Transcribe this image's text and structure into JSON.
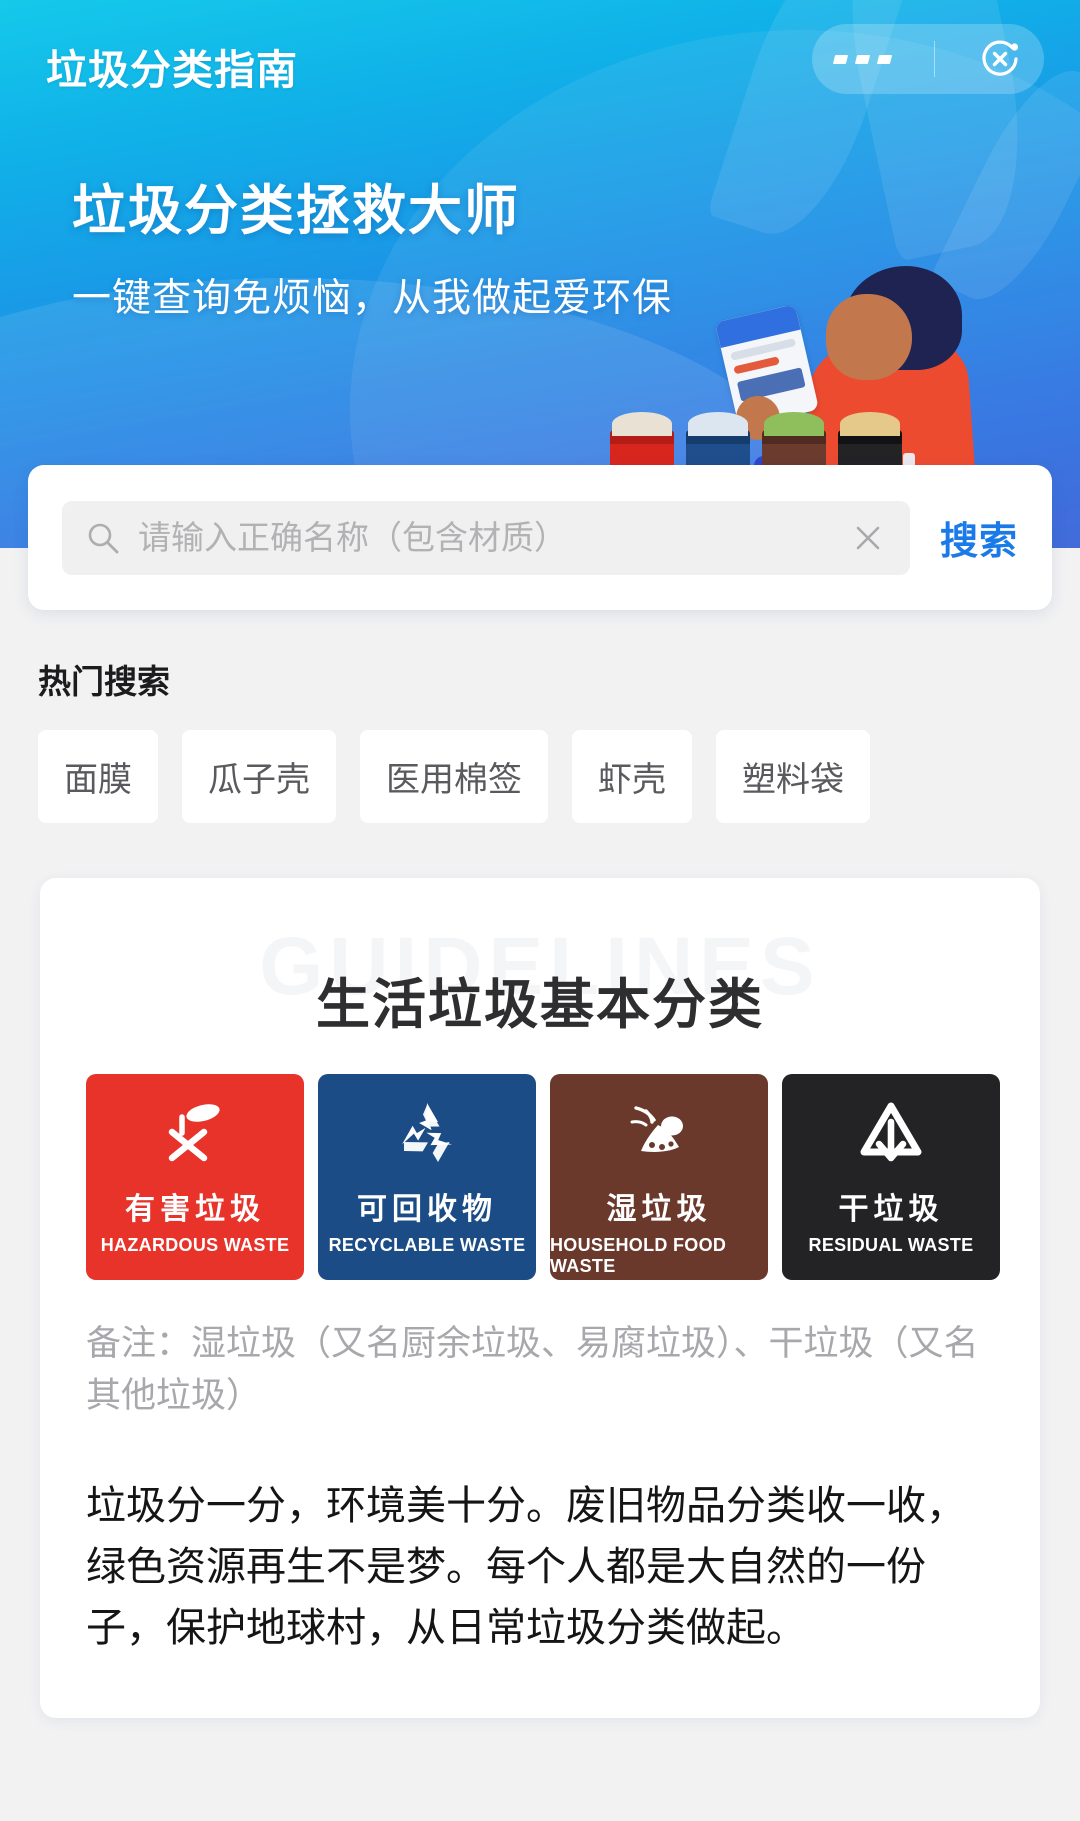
{
  "header": {
    "title": "垃圾分类指南",
    "capsule": {
      "more_icon": "more-dots-icon",
      "close_icon": "close-circle-icon"
    }
  },
  "banner": {
    "headline": "垃圾分类拯救大师",
    "subhead": "一键查询免烦恼，从我做起爱环保",
    "illustration": "person-with-phone-and-bins",
    "bins": [
      {
        "name": "hazardous-bin",
        "color": "#D8261E",
        "lid": "#B41D16"
      },
      {
        "name": "recyclable-bin",
        "color": "#1F4E8C",
        "lid": "#163C6E"
      },
      {
        "name": "wet-bin",
        "color": "#6B3B2E",
        "lid": "#512B21"
      },
      {
        "name": "dry-bin",
        "color": "#232326",
        "lid": "#121214"
      }
    ]
  },
  "search": {
    "icon": "search-icon",
    "placeholder": "请输入正确名称（包含材质）",
    "value": "",
    "clear_icon": "clear-x-icon",
    "button_label": "搜索",
    "button_color": "#1A7BE8"
  },
  "hot": {
    "title": "热门搜索",
    "items": [
      {
        "label": "面膜"
      },
      {
        "label": "瓜子壳"
      },
      {
        "label": "医用棉签"
      },
      {
        "label": "虾壳"
      },
      {
        "label": "塑料袋"
      }
    ]
  },
  "guidelines": {
    "watermark": "GUIDELINES",
    "title": "生活垃圾基本分类",
    "categories": [
      {
        "cn": "有害垃圾",
        "en": "HAZARDOUS WASTE",
        "color": "#E8332A",
        "icon": "hazardous-waste-icon"
      },
      {
        "cn": "可回收物",
        "en": "RECYCLABLE WASTE",
        "color": "#1B4C86",
        "icon": "recycle-arrows-icon"
      },
      {
        "cn": "湿垃圾",
        "en": "HOUSEHOLD FOOD WASTE",
        "color": "#6B382C",
        "icon": "food-waste-icon"
      },
      {
        "cn": "干垃圾",
        "en": "RESIDUAL WASTE",
        "color": "#232326",
        "icon": "residual-waste-icon"
      }
    ],
    "note": "备注：湿垃圾（又名厨余垃圾、易腐垃圾）、干垃圾（又名其他垃圾）",
    "body": "垃圾分一分，环境美十分。废旧物品分类收一收，绿色资源再生不是梦。每个人都是大自然的一份子，保护地球村，从日常垃圾分类做起。"
  }
}
